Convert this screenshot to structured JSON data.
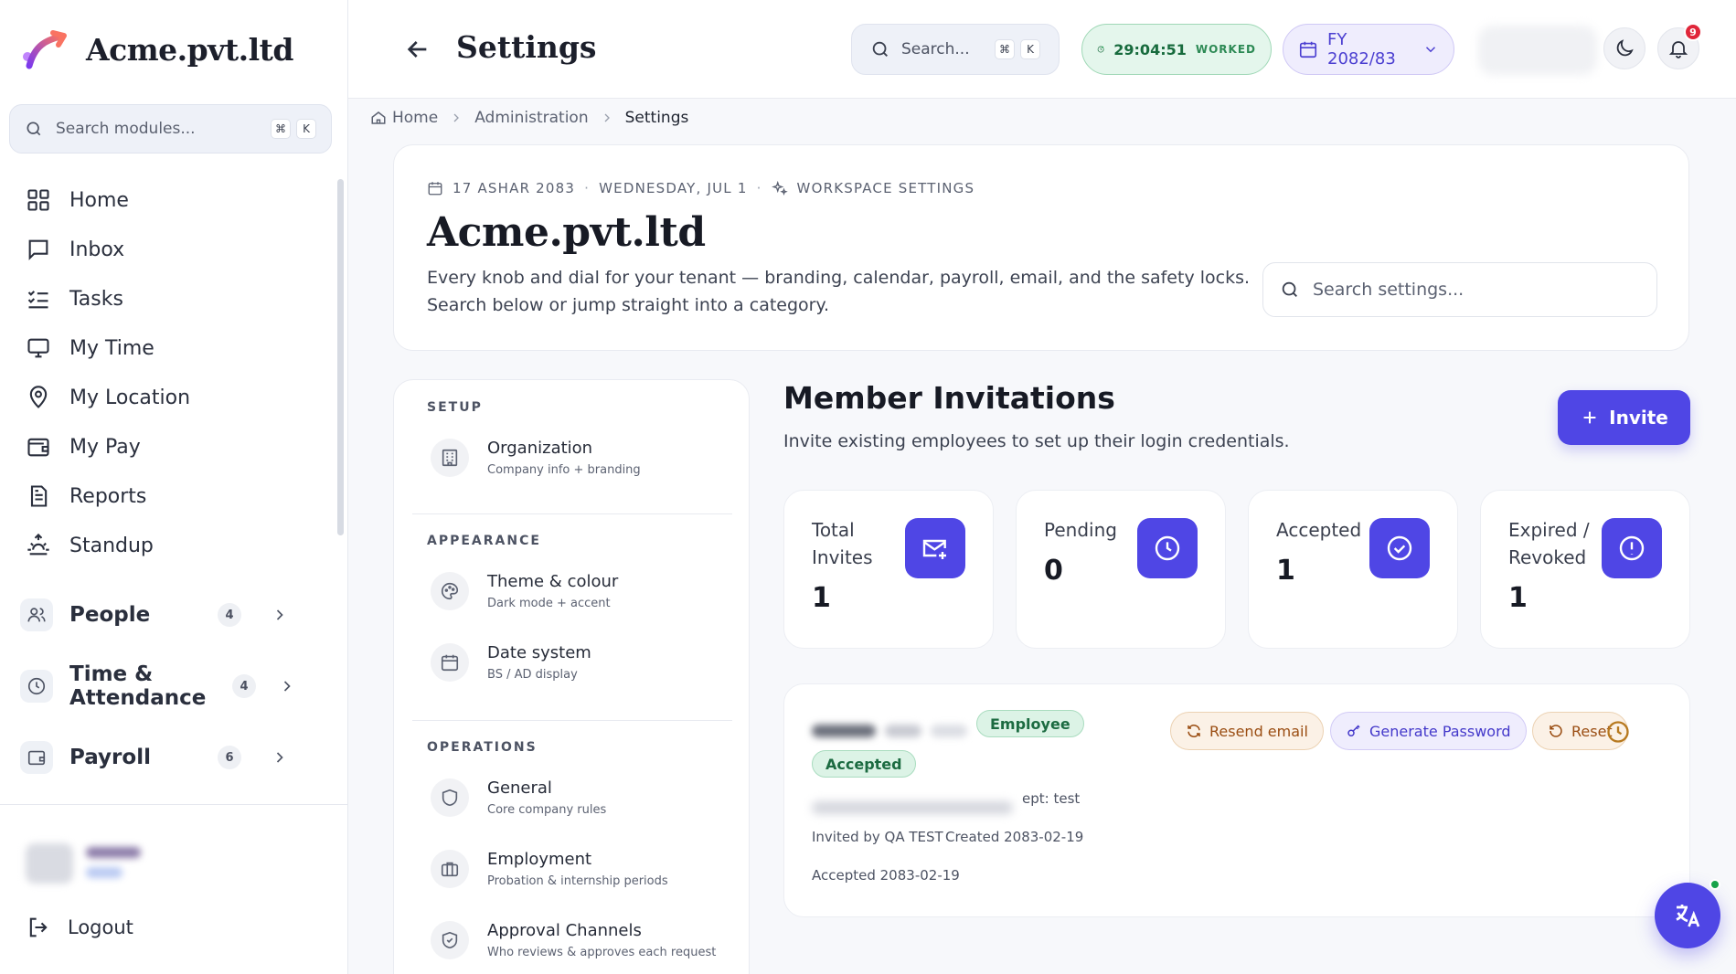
{
  "app": {
    "brand_name": "Acme.pvt.ltd",
    "accent_color": "#4f46e5"
  },
  "sidebar": {
    "search": {
      "placeholder": "Search modules...",
      "shortcut_cmd": "⌘",
      "shortcut_key": "K"
    },
    "items": [
      {
        "label": "Home",
        "icon": "grid-icon"
      },
      {
        "label": "Inbox",
        "icon": "message-icon"
      },
      {
        "label": "Tasks",
        "icon": "checklist-icon"
      },
      {
        "label": "My Time",
        "icon": "monitor-icon"
      },
      {
        "label": "My Location",
        "icon": "location-pin-icon"
      },
      {
        "label": "My Pay",
        "icon": "wallet-icon"
      },
      {
        "label": "Reports",
        "icon": "document-icon"
      },
      {
        "label": "Standup",
        "icon": "sunrise-icon"
      }
    ],
    "groups": [
      {
        "label": "People",
        "count": "4",
        "icon": "users-icon"
      },
      {
        "label": "Time & Attendance",
        "count": "4",
        "icon": "clock-icon"
      },
      {
        "label": "Payroll",
        "count": "6",
        "icon": "wallet-icon"
      }
    ],
    "logout_label": "Logout"
  },
  "header": {
    "title": "Settings",
    "search": {
      "placeholder": "Search...",
      "shortcut_cmd": "⌘",
      "shortcut_key": "K"
    },
    "worked": {
      "time": "29:04:51",
      "label": "WORKED"
    },
    "fiscal_year": "FY 2082/83",
    "notification_count": "9"
  },
  "breadcrumb": {
    "items": [
      "Home",
      "Administration",
      "Settings"
    ]
  },
  "hero": {
    "date_bs": "17 ASHAR 2083",
    "date_ad": "WEDNESDAY, JUL 1",
    "section": "WORKSPACE SETTINGS",
    "title": "Acme.pvt.ltd",
    "description": "Every knob and dial for your tenant — branding, calendar, payroll, email, and the safety locks. Search below or jump straight into a category.",
    "search_placeholder": "Search settings..."
  },
  "settings_nav": {
    "sections": [
      {
        "title": "SETUP",
        "items": [
          {
            "title": "Organization",
            "subtitle": "Company info + branding",
            "icon": "building-icon"
          }
        ]
      },
      {
        "title": "APPEARANCE",
        "items": [
          {
            "title": "Theme & colour",
            "subtitle": "Dark mode + accent",
            "icon": "palette-icon"
          },
          {
            "title": "Date system",
            "subtitle": "BS / AD display",
            "icon": "calendar-icon"
          }
        ]
      },
      {
        "title": "OPERATIONS",
        "items": [
          {
            "title": "General",
            "subtitle": "Core company rules",
            "icon": "shield-icon"
          },
          {
            "title": "Employment",
            "subtitle": "Probation & internship periods",
            "icon": "briefcase-icon"
          },
          {
            "title": "Approval Channels",
            "subtitle": "Who reviews & approves each request",
            "icon": "shield-check-icon"
          }
        ]
      }
    ]
  },
  "invitations": {
    "title": "Member Invitations",
    "subtitle": "Invite existing employees to set up their login credentials.",
    "invite_button": "Invite",
    "stats": [
      {
        "label": "Total Invites",
        "value": "1",
        "icon": "mail-plus-icon"
      },
      {
        "label": "Pending",
        "value": "0",
        "icon": "clock-icon"
      },
      {
        "label": "Accepted",
        "value": "1",
        "icon": "check-circle-icon"
      },
      {
        "label": "Expired / Revoked",
        "value": "1",
        "icon": "alert-circle-icon"
      }
    ],
    "invite": {
      "role_badge": "Employee",
      "status_badge": "Accepted",
      "dept_suffix": "ept: test",
      "invited_by": "Invited by QA TEST",
      "created": "Created 2083-02-19",
      "accepted": "Accepted 2083-02-19",
      "actions": {
        "resend": "Resend email",
        "generate": "Generate Password",
        "reset": "Reset"
      }
    }
  }
}
